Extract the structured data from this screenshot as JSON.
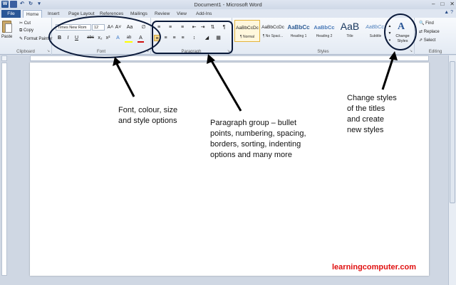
{
  "window": {
    "title": "Document1 - Microsoft Word",
    "minimize": "–",
    "maximize": "□",
    "close": "✕"
  },
  "qat": {
    "app_icon": "W",
    "icons": [
      "word-app-icon",
      "save-icon",
      "undo-icon",
      "redo-icon",
      "customize-qat-icon"
    ]
  },
  "tabs": [
    {
      "label": "File"
    },
    {
      "label": "Home"
    },
    {
      "label": "Insert"
    },
    {
      "label": "Page Layout"
    },
    {
      "label": "References"
    },
    {
      "label": "Mailings"
    },
    {
      "label": "Review"
    },
    {
      "label": "View"
    },
    {
      "label": "Add-Ins"
    }
  ],
  "clipboard": {
    "paste": "Paste",
    "cut": "Cut",
    "copy": "Copy",
    "format_painter": "Format Painter",
    "label": "Clipboard"
  },
  "font": {
    "name": "Times New Rom",
    "size": "12",
    "label": "Font",
    "grow": "A˄",
    "shrink": "A˅",
    "change_case": "Aa",
    "clear": "∅",
    "bold": "B",
    "italic": "I",
    "underline": "U",
    "strike": "abc",
    "subscript": "x₂",
    "superscript": "x²",
    "effects": "A",
    "highlight": "ab",
    "color": "A",
    "highlight_color": "#ffff00",
    "font_color": "#d01010"
  },
  "paragraph": {
    "label": "Paragraph",
    "show_marks": "¶"
  },
  "styles": {
    "label": "Styles",
    "items": [
      {
        "preview": "AaBbCcDc",
        "name": "¶ Normal"
      },
      {
        "preview": "AaBbCcDc",
        "name": "¶ No Spaci..."
      },
      {
        "preview": "AaBbCc",
        "name": "Heading 1"
      },
      {
        "preview": "AaBbCc",
        "name": "Heading 2"
      },
      {
        "preview": "AaB",
        "name": "Title"
      },
      {
        "preview": "AaBbCc.",
        "name": "Subtitle"
      }
    ],
    "change_styles": "Change Styles",
    "change_styles_glyph": "A"
  },
  "editing": {
    "label": "Editing",
    "find": "Find",
    "replace": "Replace",
    "select": "Select"
  },
  "annotations": {
    "font": "Font, colour, size\nand style options",
    "paragraph": "Paragraph group – bullet\npoints, numbering, spacing,\nborders, sorting, indenting\noptions and many more",
    "styles": "Change styles\nof the titles\nand create\nnew styles"
  },
  "watermark": "learningcomputer.com",
  "colors": {
    "annotation_ink": "#0b1a3a",
    "watermark": "#e01010",
    "file_tab": "#2b5797"
  }
}
